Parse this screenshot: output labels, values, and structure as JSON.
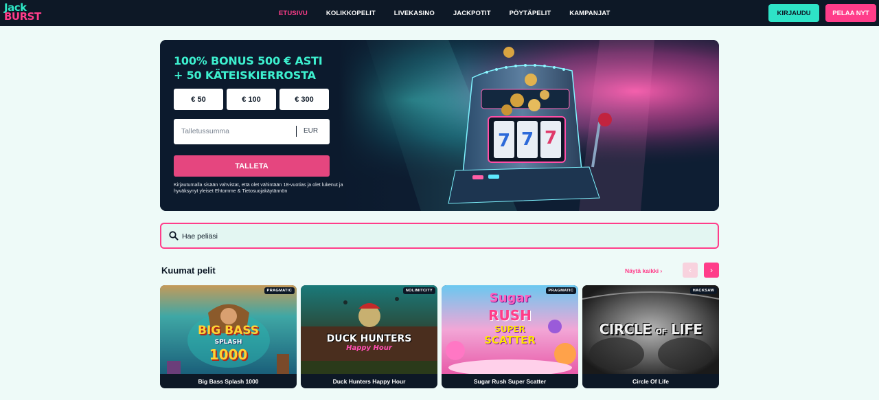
{
  "brand": {
    "line1": "Jack",
    "line2": "BURST"
  },
  "nav": {
    "items": [
      "ETUSIVU",
      "KOLIKKOPELIT",
      "LIVEKASINO",
      "JACKPOTIT",
      "PÖYTÄPELIT",
      "KAMPANJAT"
    ],
    "active": "ETUSIVU",
    "login_label": "KIRJAUDU",
    "play_label": "PELAA NYT"
  },
  "hero": {
    "title_line1": "100% BONUS 500 € ASTI",
    "title_line2": "+ 50 KÄTEISKIERROSTA",
    "amounts": [
      "€ 50",
      "€ 100",
      "€ 300"
    ],
    "deposit_placeholder": "Talletussumma",
    "currency": "EUR",
    "deposit_button": "TALLETA",
    "terms": "Kirjautumalla sisään vahvistat, että olet vähintään 18-vuotias ja olet lukenut ja hyväksynyt yleiset Ehtomme & Tietosuojakäytännön"
  },
  "search": {
    "placeholder": "Hae peliäsi"
  },
  "hot_games": {
    "title": "Kuumat pelit",
    "see_all": "Näytä kaikki",
    "see_all_chevron": "›",
    "prev_arrow": "‹",
    "next_arrow": "›",
    "games": [
      {
        "name": "Big Bass Splash 1000",
        "provider": "PRAGMATIC",
        "logo_lines": [
          "BIG BASS",
          "SPLASH",
          "1000"
        ]
      },
      {
        "name": "Duck Hunters Happy Hour",
        "provider": "NOLIMITCITY",
        "logo_lines": [
          "DUCK HUNTERS",
          "Happy Hour"
        ]
      },
      {
        "name": "Sugar Rush Super Scatter",
        "provider": "PRAGMATIC",
        "logo_lines": [
          "Sugar",
          "RUSH",
          "SUPER",
          "SCATTER"
        ]
      },
      {
        "name": "Circle Of Life",
        "provider": "HACKSAW",
        "logo_lines": [
          "CIRCLE",
          "OF",
          "LIFE"
        ]
      }
    ]
  },
  "colors": {
    "accent_pink": "#ff3d8a",
    "accent_teal": "#2ee3c7",
    "dark": "#0d1826",
    "page_bg": "#eefaf8"
  }
}
